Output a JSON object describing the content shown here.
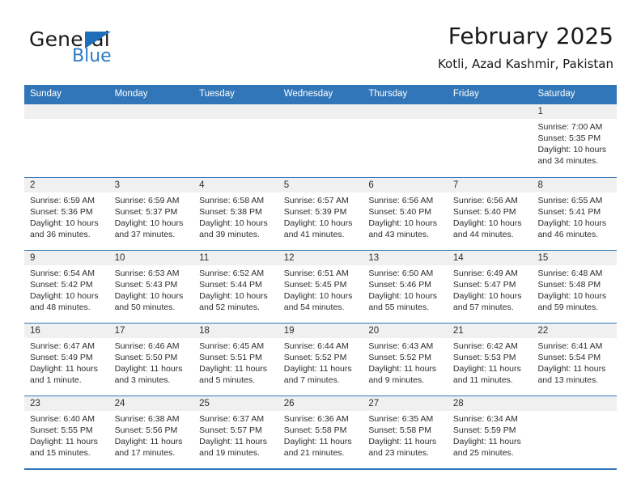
{
  "brand": {
    "word_top": "General",
    "word_bottom": "Blue",
    "triangle_icon": "blue-triangle-logo-icon",
    "accent_color": "#2b7cc4"
  },
  "header": {
    "title": "February 2025",
    "location": "Kotli, Azad Kashmir, Pakistan"
  },
  "calendar": {
    "header_color": "#3176b9",
    "strip_color": "#f0f0f0",
    "weekday_headers": [
      "Sunday",
      "Monday",
      "Tuesday",
      "Wednesday",
      "Thursday",
      "Friday",
      "Saturday"
    ],
    "weeks": [
      [
        {
          "day": "",
          "empty": true
        },
        {
          "day": "",
          "empty": true
        },
        {
          "day": "",
          "empty": true
        },
        {
          "day": "",
          "empty": true
        },
        {
          "day": "",
          "empty": true
        },
        {
          "day": "",
          "empty": true
        },
        {
          "day": "1",
          "sunrise": "Sunrise: 7:00 AM",
          "sunset": "Sunset: 5:35 PM",
          "daylight_line1": "Daylight: 10 hours",
          "daylight_line2": "and 34 minutes."
        }
      ],
      [
        {
          "day": "2",
          "sunrise": "Sunrise: 6:59 AM",
          "sunset": "Sunset: 5:36 PM",
          "daylight_line1": "Daylight: 10 hours",
          "daylight_line2": "and 36 minutes."
        },
        {
          "day": "3",
          "sunrise": "Sunrise: 6:59 AM",
          "sunset": "Sunset: 5:37 PM",
          "daylight_line1": "Daylight: 10 hours",
          "daylight_line2": "and 37 minutes."
        },
        {
          "day": "4",
          "sunrise": "Sunrise: 6:58 AM",
          "sunset": "Sunset: 5:38 PM",
          "daylight_line1": "Daylight: 10 hours",
          "daylight_line2": "and 39 minutes."
        },
        {
          "day": "5",
          "sunrise": "Sunrise: 6:57 AM",
          "sunset": "Sunset: 5:39 PM",
          "daylight_line1": "Daylight: 10 hours",
          "daylight_line2": "and 41 minutes."
        },
        {
          "day": "6",
          "sunrise": "Sunrise: 6:56 AM",
          "sunset": "Sunset: 5:40 PM",
          "daylight_line1": "Daylight: 10 hours",
          "daylight_line2": "and 43 minutes."
        },
        {
          "day": "7",
          "sunrise": "Sunrise: 6:56 AM",
          "sunset": "Sunset: 5:40 PM",
          "daylight_line1": "Daylight: 10 hours",
          "daylight_line2": "and 44 minutes."
        },
        {
          "day": "8",
          "sunrise": "Sunrise: 6:55 AM",
          "sunset": "Sunset: 5:41 PM",
          "daylight_line1": "Daylight: 10 hours",
          "daylight_line2": "and 46 minutes."
        }
      ],
      [
        {
          "day": "9",
          "sunrise": "Sunrise: 6:54 AM",
          "sunset": "Sunset: 5:42 PM",
          "daylight_line1": "Daylight: 10 hours",
          "daylight_line2": "and 48 minutes."
        },
        {
          "day": "10",
          "sunrise": "Sunrise: 6:53 AM",
          "sunset": "Sunset: 5:43 PM",
          "daylight_line1": "Daylight: 10 hours",
          "daylight_line2": "and 50 minutes."
        },
        {
          "day": "11",
          "sunrise": "Sunrise: 6:52 AM",
          "sunset": "Sunset: 5:44 PM",
          "daylight_line1": "Daylight: 10 hours",
          "daylight_line2": "and 52 minutes."
        },
        {
          "day": "12",
          "sunrise": "Sunrise: 6:51 AM",
          "sunset": "Sunset: 5:45 PM",
          "daylight_line1": "Daylight: 10 hours",
          "daylight_line2": "and 54 minutes."
        },
        {
          "day": "13",
          "sunrise": "Sunrise: 6:50 AM",
          "sunset": "Sunset: 5:46 PM",
          "daylight_line1": "Daylight: 10 hours",
          "daylight_line2": "and 55 minutes."
        },
        {
          "day": "14",
          "sunrise": "Sunrise: 6:49 AM",
          "sunset": "Sunset: 5:47 PM",
          "daylight_line1": "Daylight: 10 hours",
          "daylight_line2": "and 57 minutes."
        },
        {
          "day": "15",
          "sunrise": "Sunrise: 6:48 AM",
          "sunset": "Sunset: 5:48 PM",
          "daylight_line1": "Daylight: 10 hours",
          "daylight_line2": "and 59 minutes."
        }
      ],
      [
        {
          "day": "16",
          "sunrise": "Sunrise: 6:47 AM",
          "sunset": "Sunset: 5:49 PM",
          "daylight_line1": "Daylight: 11 hours",
          "daylight_line2": "and 1 minute."
        },
        {
          "day": "17",
          "sunrise": "Sunrise: 6:46 AM",
          "sunset": "Sunset: 5:50 PM",
          "daylight_line1": "Daylight: 11 hours",
          "daylight_line2": "and 3 minutes."
        },
        {
          "day": "18",
          "sunrise": "Sunrise: 6:45 AM",
          "sunset": "Sunset: 5:51 PM",
          "daylight_line1": "Daylight: 11 hours",
          "daylight_line2": "and 5 minutes."
        },
        {
          "day": "19",
          "sunrise": "Sunrise: 6:44 AM",
          "sunset": "Sunset: 5:52 PM",
          "daylight_line1": "Daylight: 11 hours",
          "daylight_line2": "and 7 minutes."
        },
        {
          "day": "20",
          "sunrise": "Sunrise: 6:43 AM",
          "sunset": "Sunset: 5:52 PM",
          "daylight_line1": "Daylight: 11 hours",
          "daylight_line2": "and 9 minutes."
        },
        {
          "day": "21",
          "sunrise": "Sunrise: 6:42 AM",
          "sunset": "Sunset: 5:53 PM",
          "daylight_line1": "Daylight: 11 hours",
          "daylight_line2": "and 11 minutes."
        },
        {
          "day": "22",
          "sunrise": "Sunrise: 6:41 AM",
          "sunset": "Sunset: 5:54 PM",
          "daylight_line1": "Daylight: 11 hours",
          "daylight_line2": "and 13 minutes."
        }
      ],
      [
        {
          "day": "23",
          "sunrise": "Sunrise: 6:40 AM",
          "sunset": "Sunset: 5:55 PM",
          "daylight_line1": "Daylight: 11 hours",
          "daylight_line2": "and 15 minutes."
        },
        {
          "day": "24",
          "sunrise": "Sunrise: 6:38 AM",
          "sunset": "Sunset: 5:56 PM",
          "daylight_line1": "Daylight: 11 hours",
          "daylight_line2": "and 17 minutes."
        },
        {
          "day": "25",
          "sunrise": "Sunrise: 6:37 AM",
          "sunset": "Sunset: 5:57 PM",
          "daylight_line1": "Daylight: 11 hours",
          "daylight_line2": "and 19 minutes."
        },
        {
          "day": "26",
          "sunrise": "Sunrise: 6:36 AM",
          "sunset": "Sunset: 5:58 PM",
          "daylight_line1": "Daylight: 11 hours",
          "daylight_line2": "and 21 minutes."
        },
        {
          "day": "27",
          "sunrise": "Sunrise: 6:35 AM",
          "sunset": "Sunset: 5:58 PM",
          "daylight_line1": "Daylight: 11 hours",
          "daylight_line2": "and 23 minutes."
        },
        {
          "day": "28",
          "sunrise": "Sunrise: 6:34 AM",
          "sunset": "Sunset: 5:59 PM",
          "daylight_line1": "Daylight: 11 hours",
          "daylight_line2": "and 25 minutes."
        },
        {
          "day": "",
          "empty": true
        }
      ]
    ]
  }
}
